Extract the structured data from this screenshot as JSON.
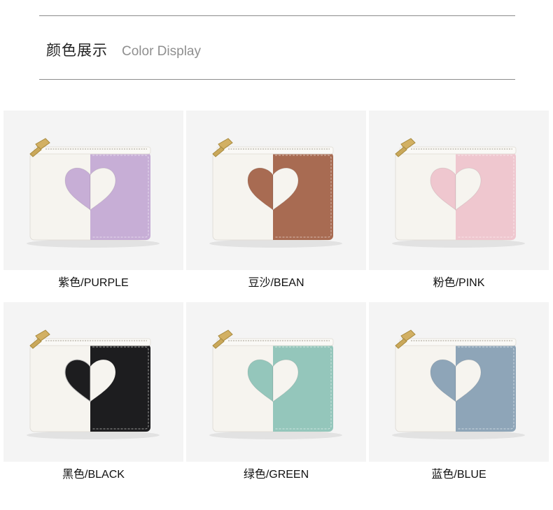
{
  "header": {
    "title_zh": "颜色展示",
    "title_en": "Color Display"
  },
  "variants": [
    {
      "label": "紫色/PURPLE",
      "color": "#c7aed6"
    },
    {
      "label": "豆沙/BEAN",
      "color": "#a86b52"
    },
    {
      "label": "粉色/PINK",
      "color": "#efc7cf"
    },
    {
      "label": "黑色/BLACK",
      "color": "#1d1d1f"
    },
    {
      "label": "绿色/GREEN",
      "color": "#94c6bb"
    },
    {
      "label": "蓝色/BLUE",
      "color": "#8ea5b8"
    }
  ]
}
